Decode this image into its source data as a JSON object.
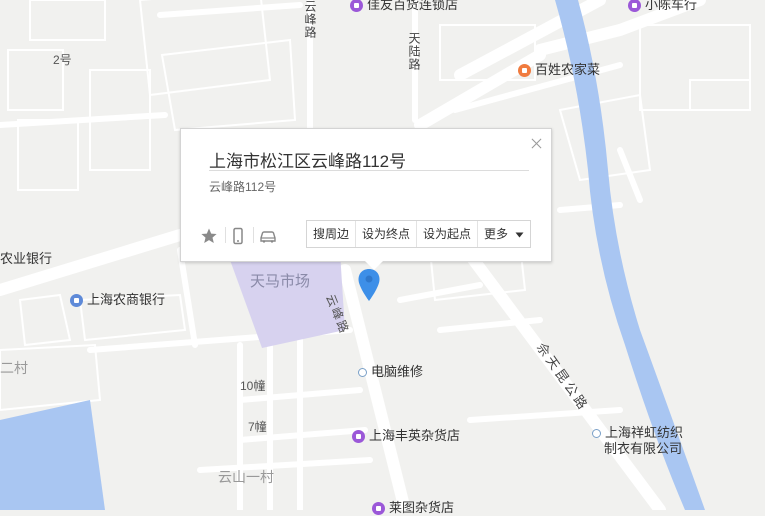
{
  "popup": {
    "title": "上海市松江区云峰路112号",
    "address": "云峰路112号",
    "buttons": {
      "nearby": "搜周边",
      "set_end": "设为终点",
      "set_start": "设为起点",
      "more": "更多"
    }
  },
  "labels": {
    "bldg_2": "2号",
    "yunfeng_top": "云峰路",
    "tianlu": "天陆路",
    "jiayou": "佳友百货连锁店",
    "xiaochen": "小陈车行",
    "baixing": "百姓农家菜",
    "agri_bank": "农业银行",
    "sh_rural_bank": "上海农商银行",
    "tianma": "天马市场",
    "yunfeng_mid": "云峰路",
    "cun2": "二村",
    "diannao": "电脑维修",
    "bldg_10": "10幢",
    "bldg_7": "7幢",
    "fengying": "上海丰英杂货店",
    "yunshan": "云山一村",
    "shetian": "佘天昆公路",
    "xianghong_1": "上海祥虹纺织",
    "xianghong_2": "制衣有限公司",
    "bottom_shop": "莱图杂货店"
  },
  "colors": {
    "background": "#f1f1ef",
    "river": "#a9c6f2",
    "market_area": "#d7d2ef",
    "marker": "#3d8fe8",
    "poi_shop": "#9b58d8",
    "poi_food": "#f07b3f",
    "poi_bank": "#5e8ad8"
  },
  "icons": [
    "star-icon",
    "phone-icon",
    "car-icon",
    "close-icon",
    "caret-down-icon",
    "location-marker-icon"
  ]
}
